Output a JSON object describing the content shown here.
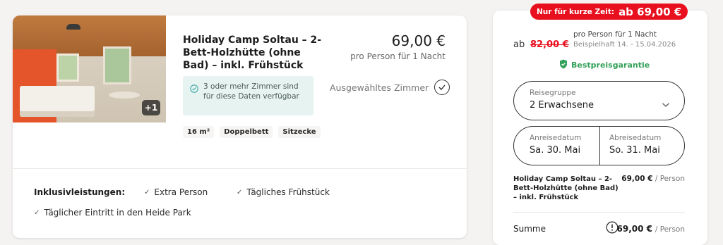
{
  "room": {
    "title": "Holiday Camp Soltau – 2-Bett-Holzhütte (ohne Bad) – inkl. Frühstück",
    "photo_badge": "+1",
    "price": "69,00 €",
    "price_note": "pro Person für 1 Nacht",
    "availability": "3 oder mehr Zimmer sind für diese Daten verfügbar",
    "selected_label": "Ausgewähltes Zimmer",
    "tags": [
      "16 m²",
      "Doppelbett",
      "Sitzecke"
    ]
  },
  "inclusions": {
    "title": "Inklusivleistungen:",
    "items": [
      "Extra Person",
      "Tägliches Frühstück",
      "Täglicher Eintritt in den Heide Park"
    ]
  },
  "sidebar": {
    "promo_label": "Nur für kurze Zeit:",
    "promo_price": "ab 69,00 €",
    "ab": "ab",
    "old_price": "82,00 €",
    "per_person_note": "pro Person für 1 Nacht",
    "example_note": "Beispielhaft 14. - 15.04.2026",
    "best_price": "Bestpreisgarantie",
    "group_label": "Reisegruppe",
    "group_value": "2 Erwachsene",
    "arrival_label": "Anreisedatum",
    "arrival_value": "Sa. 30. Mai",
    "departure_label": "Abreisedatum",
    "departure_value": "So. 31. Mai",
    "summary_title": "Holiday Camp Soltau – 2-Bett-Holzhütte (ohne Bad) – inkl. Frühstück",
    "summary_price": "69,00 €",
    "per_person": "/ Person",
    "total_label": "Summe",
    "total_price": "69,00 €"
  },
  "colors": {
    "accent_red": "#e8101f",
    "success_green": "#34a15a",
    "availability_bg": "#e6f3f1"
  },
  "icons": {
    "availability": "check-circle-icon",
    "selected": "check-circle-icon",
    "inclusion": "check-icon",
    "best_price": "shield-check-icon",
    "dropdown": "chevron-down-icon",
    "total_info": "exclamation-circle-icon"
  }
}
